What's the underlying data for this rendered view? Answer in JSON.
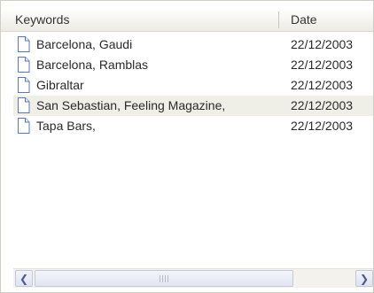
{
  "columns": {
    "keywords": "Keywords",
    "date": "Date"
  },
  "rows": [
    {
      "keywords": "Barcelona, Gaudi",
      "date": "22/12/2003",
      "selected": false
    },
    {
      "keywords": "Barcelona, Ramblas",
      "date": "22/12/2003",
      "selected": false
    },
    {
      "keywords": "Gibraltar",
      "date": "22/12/2003",
      "selected": false
    },
    {
      "keywords": "San Sebastian, Feeling Magazine,",
      "date": "22/12/2003",
      "selected": true
    },
    {
      "keywords": "Tapa Bars,",
      "date": "22/12/2003",
      "selected": false
    }
  ],
  "icons": {
    "row": "document-icon",
    "scroll_left": "chevron-left-icon",
    "scroll_right": "chevron-right-icon"
  },
  "colors": {
    "selected_row": "#efeee7",
    "scrollbar_accent": "#4a5a8a"
  }
}
